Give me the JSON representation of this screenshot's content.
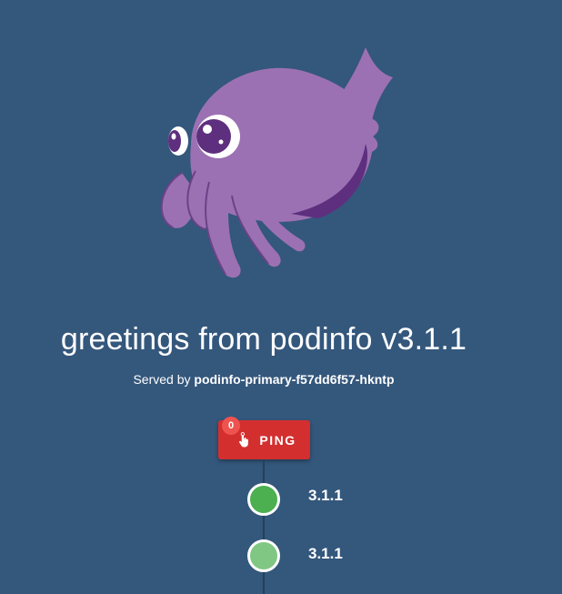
{
  "header": {
    "title": "greetings from podinfo v3.1.1",
    "served_prefix": "Served by",
    "hostname": "podinfo-primary-f57dd6f57-hkntp"
  },
  "ping_button": {
    "label": "PING",
    "badge_count": "0",
    "icon": "touch-hand-icon",
    "color": "#d32f2f"
  },
  "timeline": {
    "items": [
      {
        "label": "3.1.1",
        "color": "#4caf50"
      },
      {
        "label": "3.1.1",
        "color": "#81c784"
      }
    ]
  },
  "colors": {
    "background": "#34577c",
    "mascot": "#9c71b3"
  },
  "mascot": {
    "icon": "cuttlefish-mascot"
  }
}
